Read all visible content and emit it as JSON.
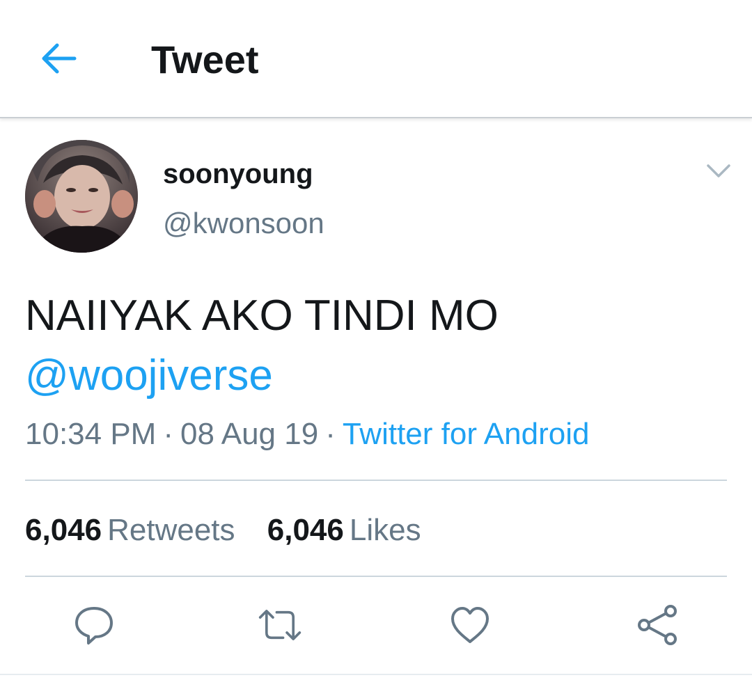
{
  "header": {
    "title": "Tweet",
    "back_icon": "arrow-left-icon",
    "accent_color": "#1da1f2"
  },
  "tweet": {
    "author": {
      "display_name": "soonyoung",
      "handle": "@kwonsoon"
    },
    "text_line1": "NAIIYAK AKO TINDI MO",
    "mention": "@woojiverse",
    "time": "10:34 PM",
    "date": "08 Aug 19",
    "separator": "·",
    "source": "Twitter for Android",
    "stats": {
      "retweets_count": "6,046",
      "retweets_label": "Retweets",
      "likes_count": "6,046",
      "likes_label": "Likes"
    }
  },
  "actions": [
    {
      "icon": "reply-icon"
    },
    {
      "icon": "retweet-icon"
    },
    {
      "icon": "like-heart-icon"
    },
    {
      "icon": "share-icon"
    }
  ],
  "colors": {
    "text_primary": "#14171a",
    "text_secondary": "#657786",
    "link": "#1da1f2",
    "divider": "#ccd6dd"
  }
}
